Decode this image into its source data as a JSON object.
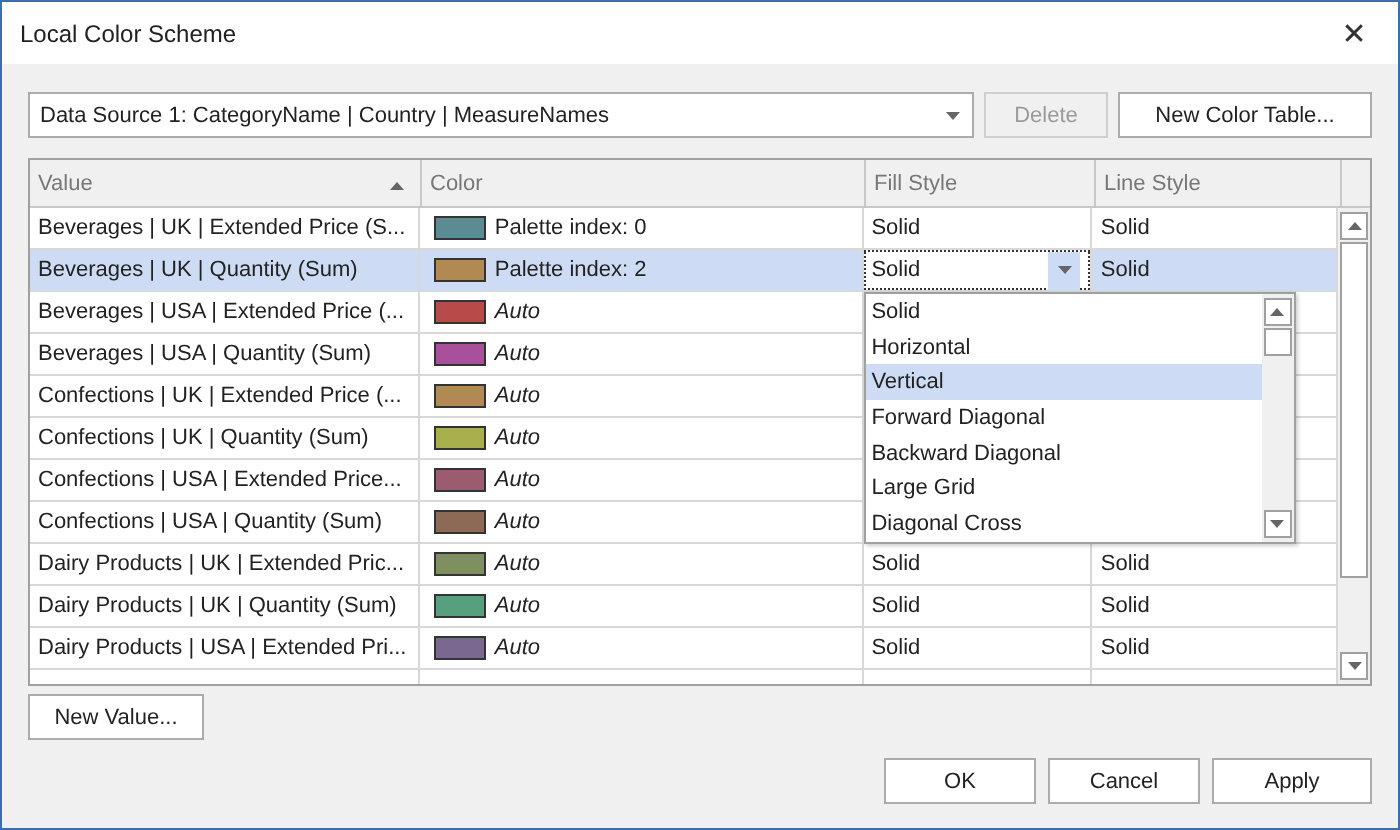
{
  "window": {
    "title": "Local Color Scheme",
    "close": "✕"
  },
  "source": {
    "value": "Data Source 1: CategoryName | Country | MeasureNames"
  },
  "toolbar_buttons": [
    {
      "label": "Delete",
      "disabled": true
    },
    {
      "label": "New Color Table...",
      "disabled": false
    }
  ],
  "table": {
    "columns": [
      {
        "label": "Value",
        "sorted": true
      },
      {
        "label": "Color",
        "sorted": false
      },
      {
        "label": "Fill Style",
        "sorted": false
      },
      {
        "label": "Line Style",
        "sorted": false
      }
    ],
    "rows": [
      {
        "value": "Beverages | UK | Extended Price (S...",
        "color": "#5b8c94",
        "color_label": "Palette index: 0",
        "kind": "palette",
        "fill_style": "Solid",
        "line_style": "Solid",
        "selected": false
      },
      {
        "value": "Beverages | UK | Quantity (Sum)",
        "color": "#b08a52",
        "color_label": "Palette index: 2",
        "kind": "palette",
        "fill_style": "Solid",
        "line_style": "Solid",
        "selected": true
      },
      {
        "value": "Beverages | USA | Extended Price (...",
        "color": "#b84a4a",
        "color_label": "Auto",
        "kind": "auto",
        "selected": false
      },
      {
        "value": "Beverages | USA | Quantity (Sum)",
        "color": "#a8509c",
        "color_label": "Auto",
        "kind": "auto",
        "selected": false
      },
      {
        "value": "Confections | UK | Extended Price (...",
        "color": "#b08a52",
        "color_label": "Auto",
        "kind": "auto",
        "selected": false
      },
      {
        "value": "Confections | UK | Quantity (Sum)",
        "color": "#a8b04e",
        "color_label": "Auto",
        "kind": "auto",
        "selected": false
      },
      {
        "value": "Confections | USA | Extended Price...",
        "color": "#9a5c6e",
        "color_label": "Auto",
        "kind": "auto",
        "selected": false
      },
      {
        "value": "Confections | USA | Quantity (Sum)",
        "color": "#8c6a56",
        "color_label": "Auto",
        "kind": "auto",
        "selected": false
      },
      {
        "value": "Dairy Products | UK | Extended Pric...",
        "color": "#7e9060",
        "color_label": "Auto",
        "kind": "auto",
        "fill_style": "Solid",
        "line_style": "Solid",
        "selected": false
      },
      {
        "value": "Dairy Products | UK | Quantity (Sum)",
        "color": "#56a07e",
        "color_label": "Auto",
        "kind": "auto",
        "fill_style": "Solid",
        "line_style": "Solid",
        "selected": false
      },
      {
        "value": "Dairy Products | USA | Extended Pri...",
        "color": "#7a6890",
        "color_label": "Auto",
        "kind": "auto",
        "fill_style": "Solid",
        "line_style": "Solid",
        "selected": false
      }
    ]
  },
  "fill_dropdown": {
    "items": [
      {
        "label": "Solid",
        "selected": false
      },
      {
        "label": "Horizontal",
        "selected": false
      },
      {
        "label": "Vertical",
        "selected": true
      },
      {
        "label": "Forward Diagonal",
        "selected": false
      },
      {
        "label": "Backward Diagonal",
        "selected": false
      },
      {
        "label": "Large Grid",
        "selected": false
      },
      {
        "label": "Diagonal Cross",
        "selected": false
      }
    ]
  },
  "new_value_button": "New Value...",
  "footer_buttons": [
    "OK",
    "Cancel",
    "Apply"
  ]
}
